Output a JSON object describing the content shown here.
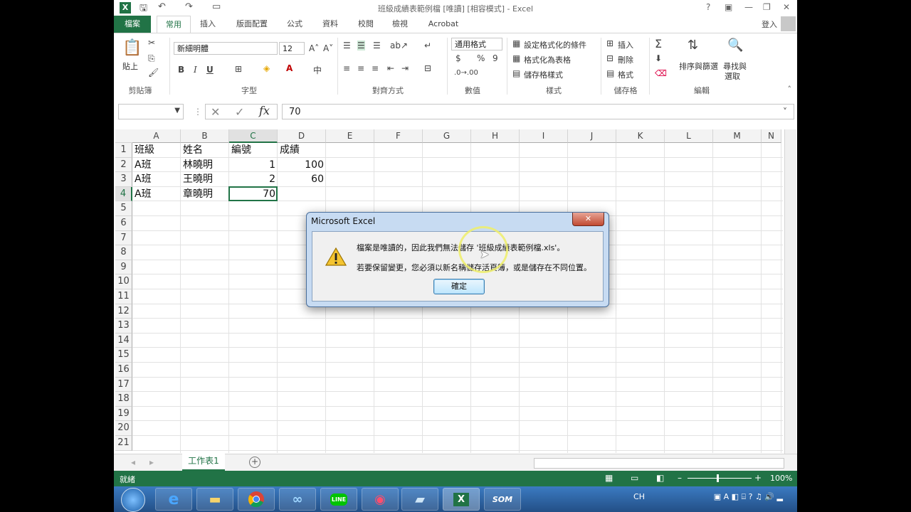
{
  "window": {
    "title": "班級成績表範例檔 [唯讀] [相容模式] - Excel",
    "help": "?",
    "signin": "登入"
  },
  "tabs": [
    "檔案",
    "常用",
    "插入",
    "版面配置",
    "公式",
    "資料",
    "校閱",
    "檢視",
    "Acrobat"
  ],
  "ribbon": {
    "clipboard": {
      "label": "剪貼簿",
      "paste": "貼上"
    },
    "font": {
      "label": "字型",
      "name": "新細明體",
      "size": "12",
      "bold": "B",
      "italic": "I",
      "underline": "U",
      "grow": "A˄",
      "shrink": "A˅"
    },
    "alignment": {
      "label": "對齊方式"
    },
    "number": {
      "label": "數值",
      "format": "通用格式",
      "currency": "$",
      "percent": "%",
      "comma": "9"
    },
    "styles": {
      "label": "樣式",
      "conditional": "設定格式化的條件",
      "table": "格式化為表格",
      "cell_styles": "儲存格樣式"
    },
    "cells": {
      "label": "儲存格",
      "insert": "插入",
      "delete": "刪除",
      "format": "格式"
    },
    "editing": {
      "label": "編輯",
      "sort": "排序與篩選",
      "find": "尋找與",
      "select": "選取"
    }
  },
  "formula_bar": {
    "value": "70",
    "fx": "fx"
  },
  "columns": [
    "A",
    "B",
    "C",
    "D",
    "E",
    "F",
    "G",
    "H",
    "I",
    "J",
    "K",
    "L",
    "M",
    "N"
  ],
  "rows": [
    "1",
    "2",
    "3",
    "4",
    "5",
    "6",
    "7",
    "8",
    "9",
    "10",
    "11",
    "12",
    "13",
    "14",
    "15",
    "16",
    "17",
    "18",
    "19",
    "20",
    "21"
  ],
  "cells": {
    "A1": "班級",
    "B1": "姓名",
    "C1": "編號",
    "D1": "成績",
    "A2": "A班",
    "B2": "林曉明",
    "C2": "1",
    "D2": "100",
    "A3": "A班",
    "B3": "王曉明",
    "C3": "2",
    "D3": "60",
    "A4": "A班",
    "B4": "章曉明",
    "C4": "70"
  },
  "selected_cell": "C4",
  "sheet_tab": "工作表1",
  "status": {
    "ready": "就緒",
    "zoom": "100%"
  },
  "dialog": {
    "title": "Microsoft Excel",
    "line1": "檔案是唯讀的，因此我們無法儲存 '班級成績表範例檔.xls'。",
    "line2": "若要保留變更，您必須以新名稱儲存活頁簿，或是儲存在不同位置。",
    "ok": "確定",
    "close": "✕"
  },
  "taskbar": {
    "som": "SOM",
    "line": "LINE",
    "tray_lang": "CH"
  },
  "colors": {
    "accent": "#217346",
    "dialog_frame": "#c7dbf2",
    "close_red": "#c14a32"
  }
}
